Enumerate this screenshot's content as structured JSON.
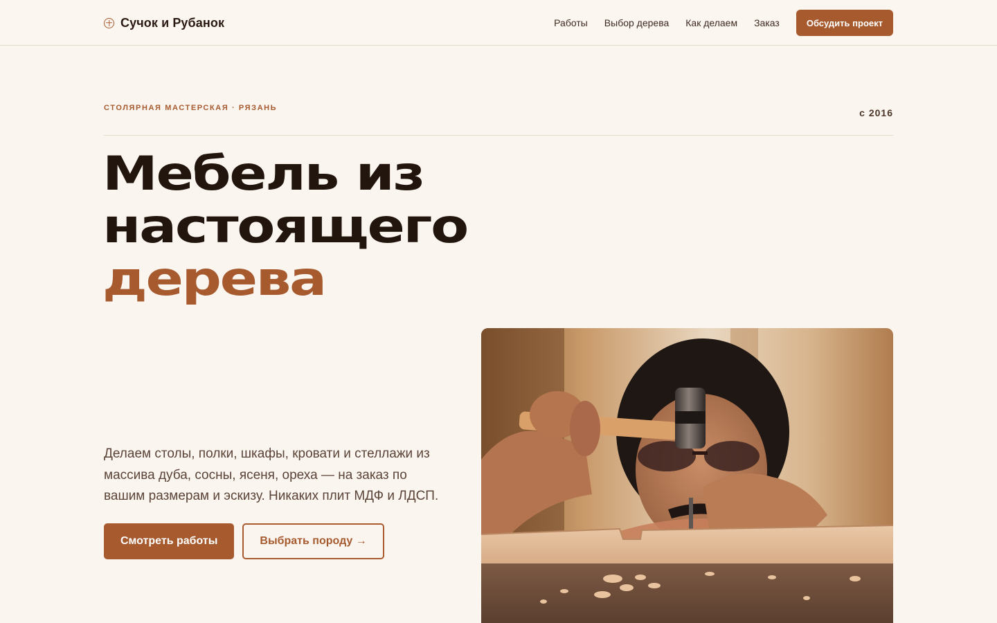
{
  "header": {
    "logo_text": "Сучок и Рубанок",
    "logo_icon": "circle-plus-icon",
    "nav": [
      {
        "label": "Работы"
      },
      {
        "label": "Выбор дерева"
      },
      {
        "label": "Как делаем"
      },
      {
        "label": "Заказ"
      }
    ],
    "cta_label": "Обсудить проект"
  },
  "hero": {
    "eyebrow": "Столярная мастерская · Рязань",
    "since": "с 2016",
    "headline_line1": "Мебель из",
    "headline_line2": "настоящего",
    "headline_accent": "дерева",
    "lead": "Делаем столы, полки, шкафы, кровати и стеллажи из массива дуба, сосны, ясеня, ореха — на заказ по вашим размерам и эскизу. Никаких плит МДФ и ЛДСП.",
    "primary_button": "Смотреть работы",
    "secondary_button": "Выбрать породу →"
  },
  "colors": {
    "accent": "#a65a2e",
    "background": "#fbf5f0",
    "text_dark": "#22150e"
  }
}
